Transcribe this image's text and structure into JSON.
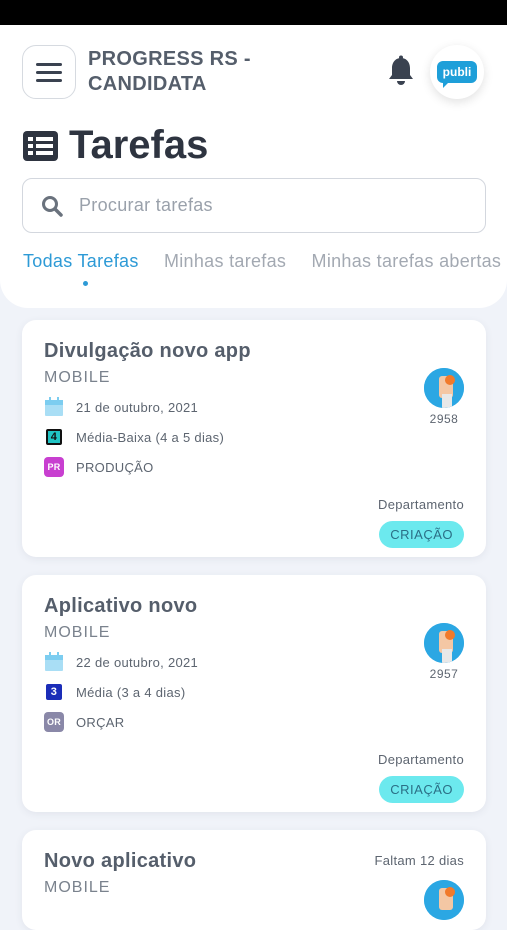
{
  "header": {
    "app_title": "PROGRESS RS - CANDIDATA",
    "logo_text": "publi",
    "page_title": "Tarefas"
  },
  "search": {
    "placeholder": "Procurar tarefas",
    "value": ""
  },
  "tabs": [
    {
      "label": "Todas Tarefas",
      "active": true
    },
    {
      "label": "Minhas tarefas",
      "active": false
    },
    {
      "label": "Minhas tarefas abertas",
      "active": false
    }
  ],
  "tasks": [
    {
      "title": "Divulgação novo app",
      "project": "MOBILE",
      "date": "21 de outubro, 2021",
      "priority_num": "4",
      "priority_label": "Média-Baixa (4 a 5 dias)",
      "priority_color": "#20c4c4",
      "dept_code": "PR",
      "dept_name": "PRODUÇÃO",
      "dept_color": "#c83fd0",
      "user_id": "2958",
      "department_label": "Departamento",
      "department": "CRIAÇÃO"
    },
    {
      "title": "Aplicativo novo",
      "project": "MOBILE",
      "date": "22 de outubro, 2021",
      "priority_num": "3",
      "priority_label": "Média (3 a 4 dias)",
      "priority_color": "#1b2db8",
      "dept_code": "OR",
      "dept_name": "ORÇAR",
      "dept_color": "#8a88a8",
      "user_id": "2957",
      "department_label": "Departamento",
      "department": "CRIAÇÃO"
    },
    {
      "title": "Novo aplicativo",
      "project": "MOBILE",
      "deadline": "Faltam 12 dias"
    }
  ],
  "colors": {
    "accent": "#2d9ad6",
    "pill": "#6ce9ee",
    "logo": "#1e9fd9"
  },
  "icons": [
    "menu-icon",
    "bell-icon",
    "list-icon",
    "search-icon",
    "calendar-icon",
    "avatar-icon"
  ]
}
